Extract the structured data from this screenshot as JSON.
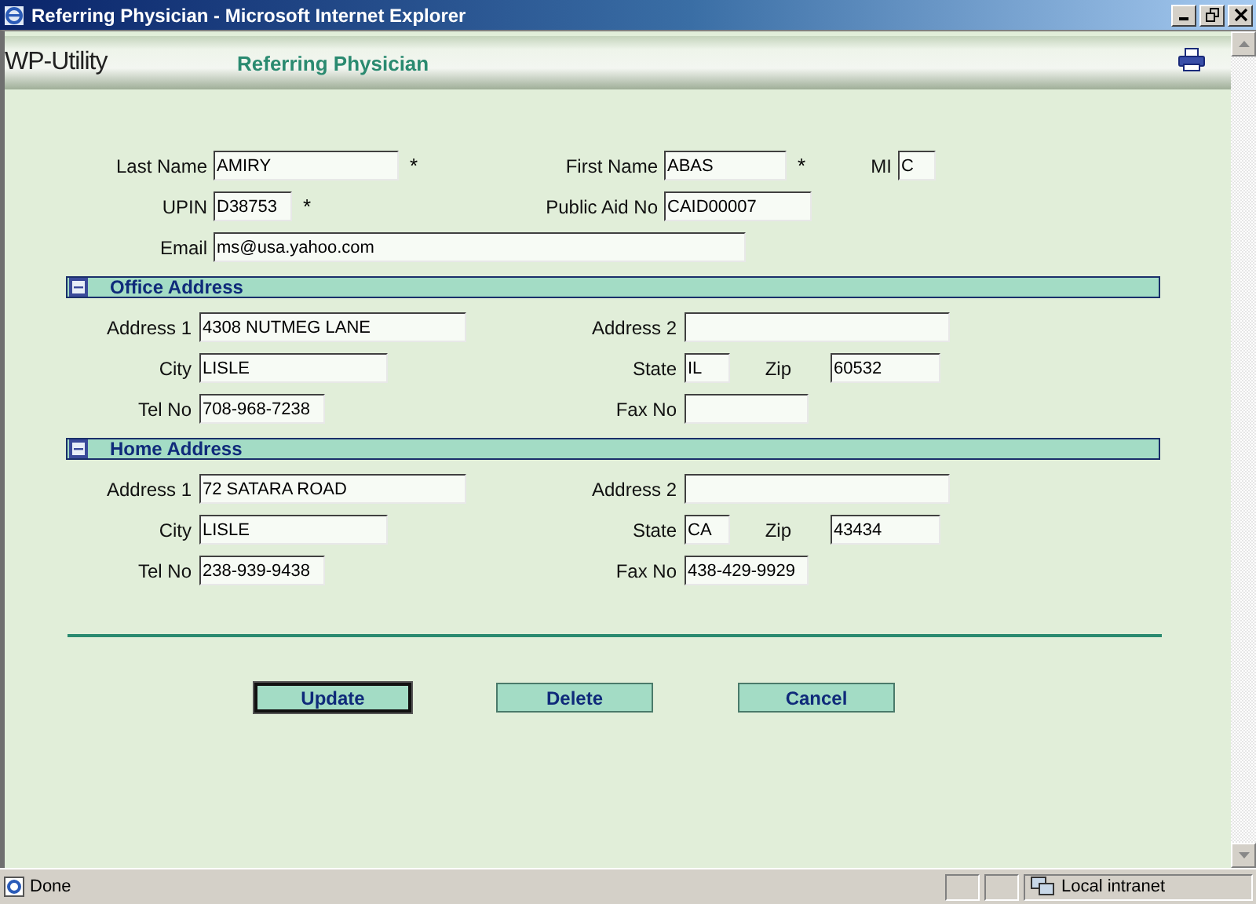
{
  "window": {
    "title": "Referring Physician - Microsoft Internet Explorer"
  },
  "header": {
    "app_name": "WP-Utility",
    "page_title": "Referring Physician"
  },
  "physician": [
    {
      "label": "Last Name",
      "value": "AMIRY",
      "note": "*"
    },
    {
      "label": "First Name",
      "value": "ABAS",
      "note": "*"
    },
    {
      "label": "MI",
      "value": "C"
    },
    {
      "label": "UPIN",
      "value": "D38753",
      "note": "*"
    },
    {
      "label": "Public Aid No",
      "value": "CAID00007"
    },
    {
      "label": "Email",
      "value": "ms@usa.yahoo.com"
    }
  ],
  "sections": [
    {
      "title": "Office Address",
      "expanded": true,
      "fields": [
        {
          "label": "Address 1",
          "value": "4308 NUTMEG LANE"
        },
        {
          "label": "Address 2"
        },
        {
          "label": "City",
          "value": "LISLE"
        },
        {
          "label": "State",
          "value": "IL"
        },
        {
          "label": "Zip",
          "value": "60532"
        },
        {
          "label": "Tel No",
          "value": "708-968-7238"
        },
        {
          "label": "Fax No"
        }
      ]
    },
    {
      "title": "Home Address",
      "expanded": true,
      "fields": [
        {
          "label": "Address 1",
          "value": "72 SATARA ROAD"
        },
        {
          "label": "Address 2"
        },
        {
          "label": "City",
          "value": "LISLE"
        },
        {
          "label": "State",
          "value": "CA"
        },
        {
          "label": "Zip",
          "value": "43434"
        },
        {
          "label": "Tel No",
          "value": "238-939-9438"
        },
        {
          "label": "Fax No",
          "value": "438-429-9929"
        }
      ]
    }
  ],
  "buttons": [
    {
      "label": "Update",
      "focused": true
    },
    {
      "label": "Delete",
      "focused": false
    },
    {
      "label": "Cancel",
      "focused": false
    }
  ],
  "status_bar": {
    "text": "Done",
    "zone": "Local intranet"
  }
}
